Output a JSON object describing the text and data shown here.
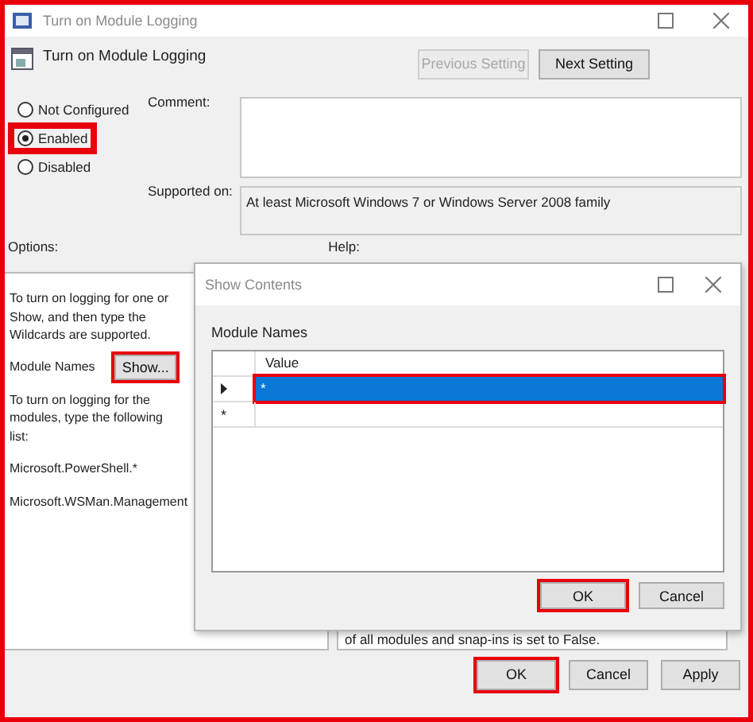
{
  "window": {
    "title": "Turn on Module Logging"
  },
  "header": {
    "title": "Turn on Module Logging",
    "buttons": [
      {
        "label": "Previous Setting",
        "disabled": true
      },
      {
        "label": "Next Setting",
        "disabled": false
      }
    ]
  },
  "states": [
    {
      "label": "Not Configured",
      "selected": false,
      "highlighted": false
    },
    {
      "label": "Enabled",
      "selected": true,
      "highlighted": true
    },
    {
      "label": "Disabled",
      "selected": false,
      "highlighted": false
    }
  ],
  "comment": {
    "label": "Comment:"
  },
  "supported": {
    "label": "Supported on:",
    "value": "At least Microsoft Windows 7 or Windows Server 2008 family"
  },
  "options": {
    "label": "Options:",
    "items": [
      {
        "kind": "line",
        "text": "To turn on logging for one or"
      },
      {
        "kind": "line",
        "text": "Show, and then type the"
      },
      {
        "kind": "line",
        "text": "Wildcards are supported."
      },
      {
        "kind": "field",
        "text": "Module Names",
        "button": "Show...",
        "highlighted": true
      },
      {
        "kind": "line",
        "text": "To turn on logging for the"
      },
      {
        "kind": "line",
        "text": "modules, type the following"
      },
      {
        "kind": "line",
        "text": "list:"
      },
      {
        "kind": "para",
        "text": "Microsoft.PowerShell.*"
      },
      {
        "kind": "para",
        "text": "Microsoft.WSMan.Management"
      }
    ]
  },
  "help": {
    "label": "Help:",
    "last_line": "of all modules and snap-ins is set to False."
  },
  "buttons": [
    {
      "label": "OK",
      "highlighted": true
    },
    {
      "label": "Cancel",
      "highlighted": false
    },
    {
      "label": "Apply",
      "highlighted": false
    }
  ],
  "dialog": {
    "title": "Show Contents",
    "group_label": "Module Names",
    "columns": [
      "Value"
    ],
    "rows": [
      {
        "kind": "current",
        "value": "*",
        "selected": true,
        "highlighted": true
      },
      {
        "kind": "new",
        "marker": "*",
        "selected": false,
        "highlighted": false
      }
    ],
    "buttons": [
      {
        "label": "OK",
        "highlighted": true
      },
      {
        "label": "Cancel",
        "highlighted": false
      }
    ]
  }
}
